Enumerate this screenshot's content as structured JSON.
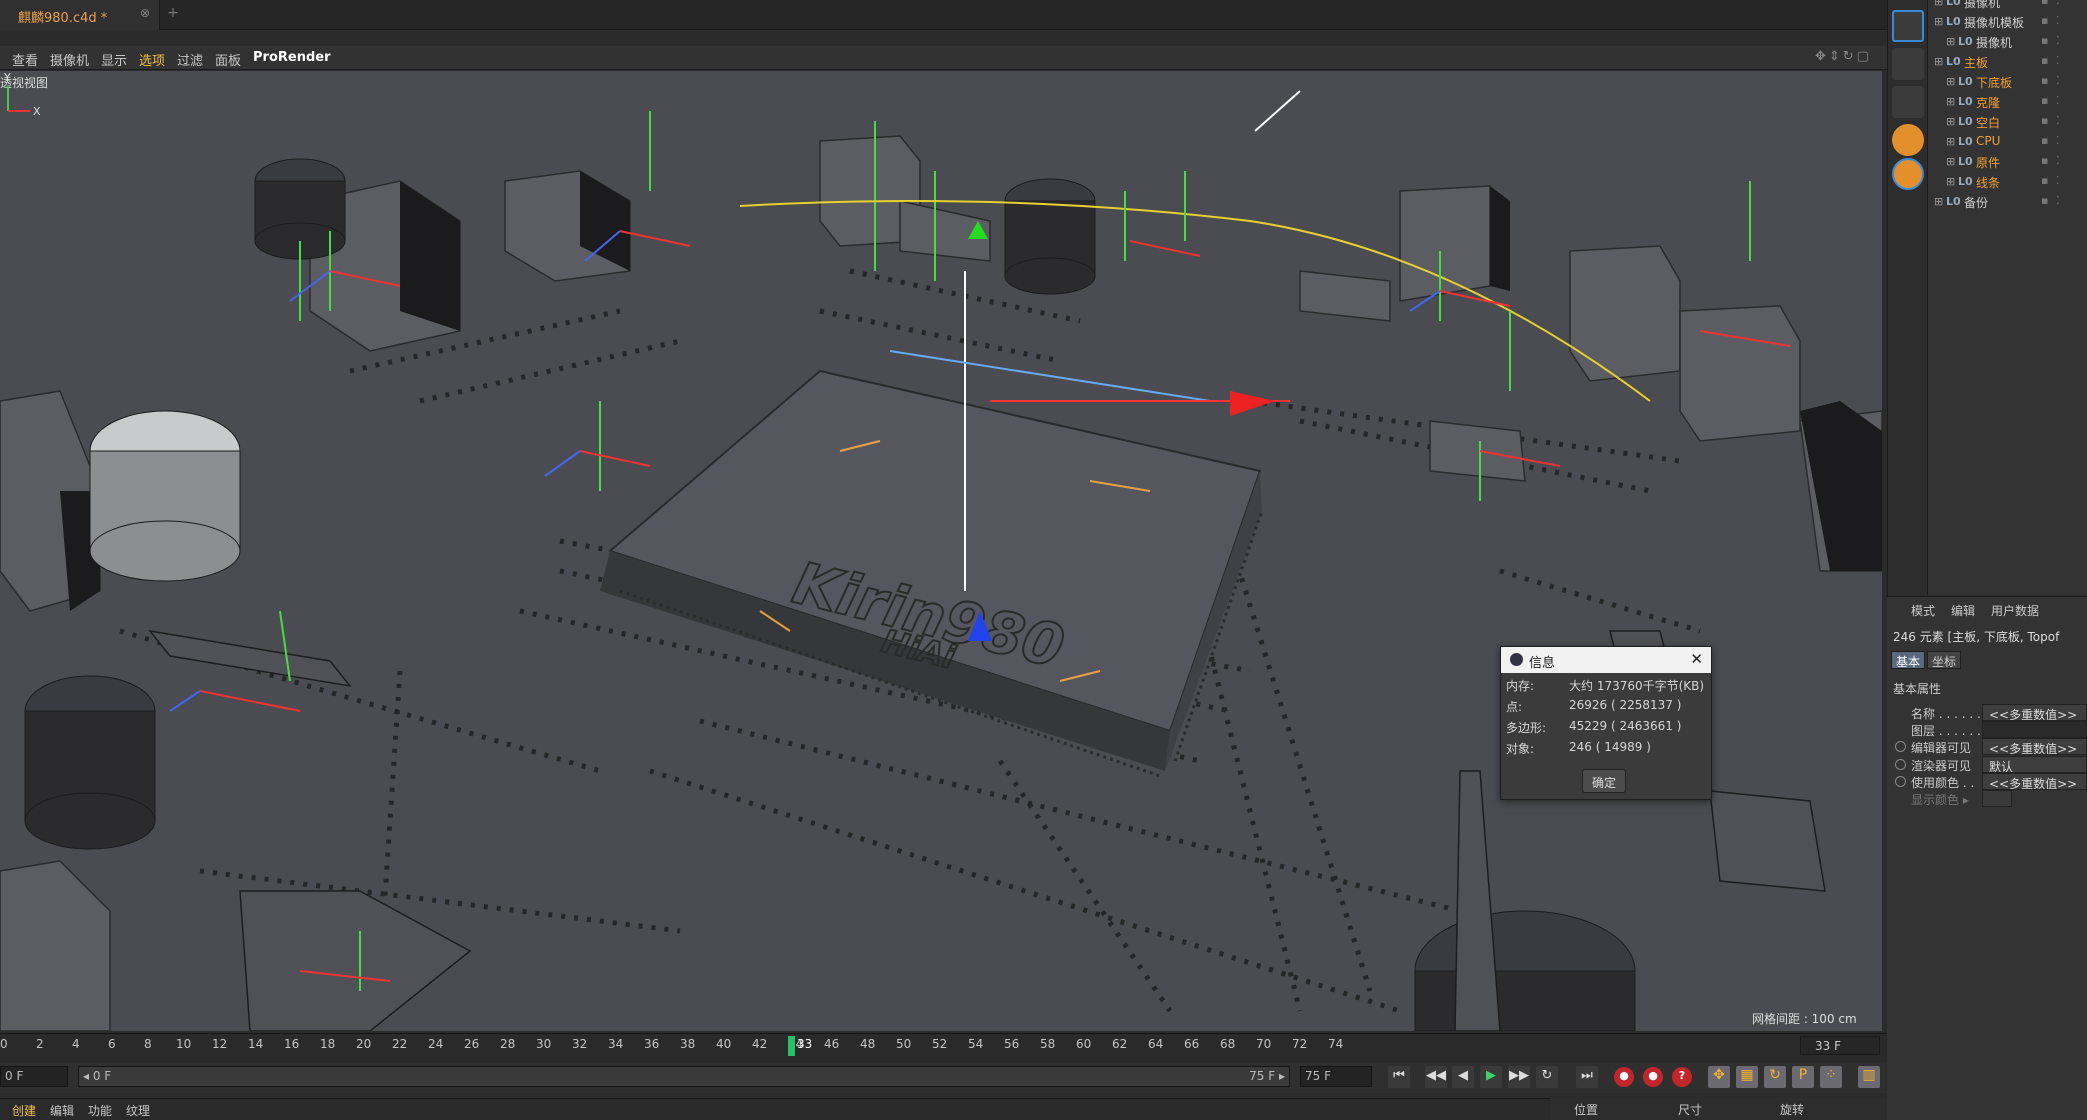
{
  "document": {
    "tab_title": "麒麟980.c4d *",
    "close": "⊗",
    "new_tab": "+"
  },
  "viewport_menu": [
    "查看",
    "摄像机",
    "显示",
    "选项",
    "过滤",
    "面板",
    "ProRender"
  ],
  "viewport": {
    "title": "透视视图",
    "grid_spacing": "网格间距 : 100 cm",
    "axis_y": "Y",
    "axis_x": "X",
    "chip_brand": "Kirin980",
    "chip_sub": "HiAi"
  },
  "dialog": {
    "title": "信息",
    "rows": [
      {
        "label": "内存:",
        "value": "大约 173760千字节(KB)"
      },
      {
        "label": "点:",
        "value": "26926 ( 2258137 )"
      },
      {
        "label": "多边形:",
        "value": "45229 ( 2463661 )"
      },
      {
        "label": "对象:",
        "value": "246 ( 14989 )"
      }
    ],
    "ok_label": "确定"
  },
  "timeline": {
    "ticks": [
      "0",
      "2",
      "4",
      "6",
      "8",
      "10",
      "12",
      "14",
      "16",
      "18",
      "20",
      "22",
      "24",
      "26",
      "28",
      "30",
      "32",
      "34",
      "36",
      "38",
      "40",
      "42",
      "44",
      "46",
      "48",
      "50",
      "52",
      "54",
      "56",
      "58",
      "60",
      "62",
      "64",
      "66",
      "68",
      "70",
      "72",
      "74"
    ],
    "current_frame": "33",
    "end_frame_display": "33 F"
  },
  "transport": {
    "start_field": "0 F",
    "range_start": "◂ 0 F",
    "range_end": "75 F ▸",
    "end_field": "75 F",
    "buttons": [
      "⏮",
      "◀◀",
      "◀",
      "▶",
      "▶▶",
      "⏭"
    ],
    "record_labels": [
      "●",
      "●",
      "?"
    ],
    "tool_icons": [
      "✥",
      "▦",
      "↻",
      "P",
      "⁘",
      "▥"
    ]
  },
  "bottom_menu": [
    "创建",
    "编辑",
    "功能",
    "纹理"
  ],
  "coords_header": [
    "位置",
    "尺寸",
    "旋转"
  ],
  "objects": [
    {
      "name": "摄像机",
      "indent": 0,
      "color": "white"
    },
    {
      "name": "摄像机模板",
      "indent": 0,
      "color": "white"
    },
    {
      "name": "摄像机",
      "indent": 1,
      "color": "white"
    },
    {
      "name": "主板",
      "indent": 0,
      "color": "orange"
    },
    {
      "name": "下底板",
      "indent": 1,
      "color": "orange"
    },
    {
      "name": "克隆",
      "indent": 1,
      "color": "orange"
    },
    {
      "name": "空白",
      "indent": 1,
      "color": "orange"
    },
    {
      "name": "CPU",
      "indent": 1,
      "color": "orange"
    },
    {
      "name": "原件",
      "indent": 1,
      "color": "orange"
    },
    {
      "name": "线条",
      "indent": 1,
      "color": "orange"
    },
    {
      "name": "备份",
      "indent": 0,
      "color": "white"
    }
  ],
  "attributes": {
    "menu": [
      "模式",
      "编辑",
      "用户数据"
    ],
    "selection": "246 元素 [主板, 下底板, Topof",
    "tabs": [
      "基本",
      "坐标"
    ],
    "section": "基本属性",
    "rows": [
      {
        "label": "名称 . . . . . . .",
        "value": "<<多重数值>>",
        "radio": false
      },
      {
        "label": "图层 . . . . . . .",
        "value": "",
        "radio": false
      },
      {
        "label": "编辑器可见",
        "value": "<<多重数值>>",
        "radio": true
      },
      {
        "label": "渲染器可见",
        "value": "默认",
        "radio": true
      },
      {
        "label": "使用颜色 . .",
        "value": "<<多重数值>>",
        "radio": true
      },
      {
        "label": "显示颜色 ▸",
        "value": "",
        "radio": false
      }
    ]
  },
  "colors": {
    "accent": "#f0c040",
    "orange": "#f0a030",
    "viewport": "#4b4c52",
    "playhead": "#27c06a"
  }
}
